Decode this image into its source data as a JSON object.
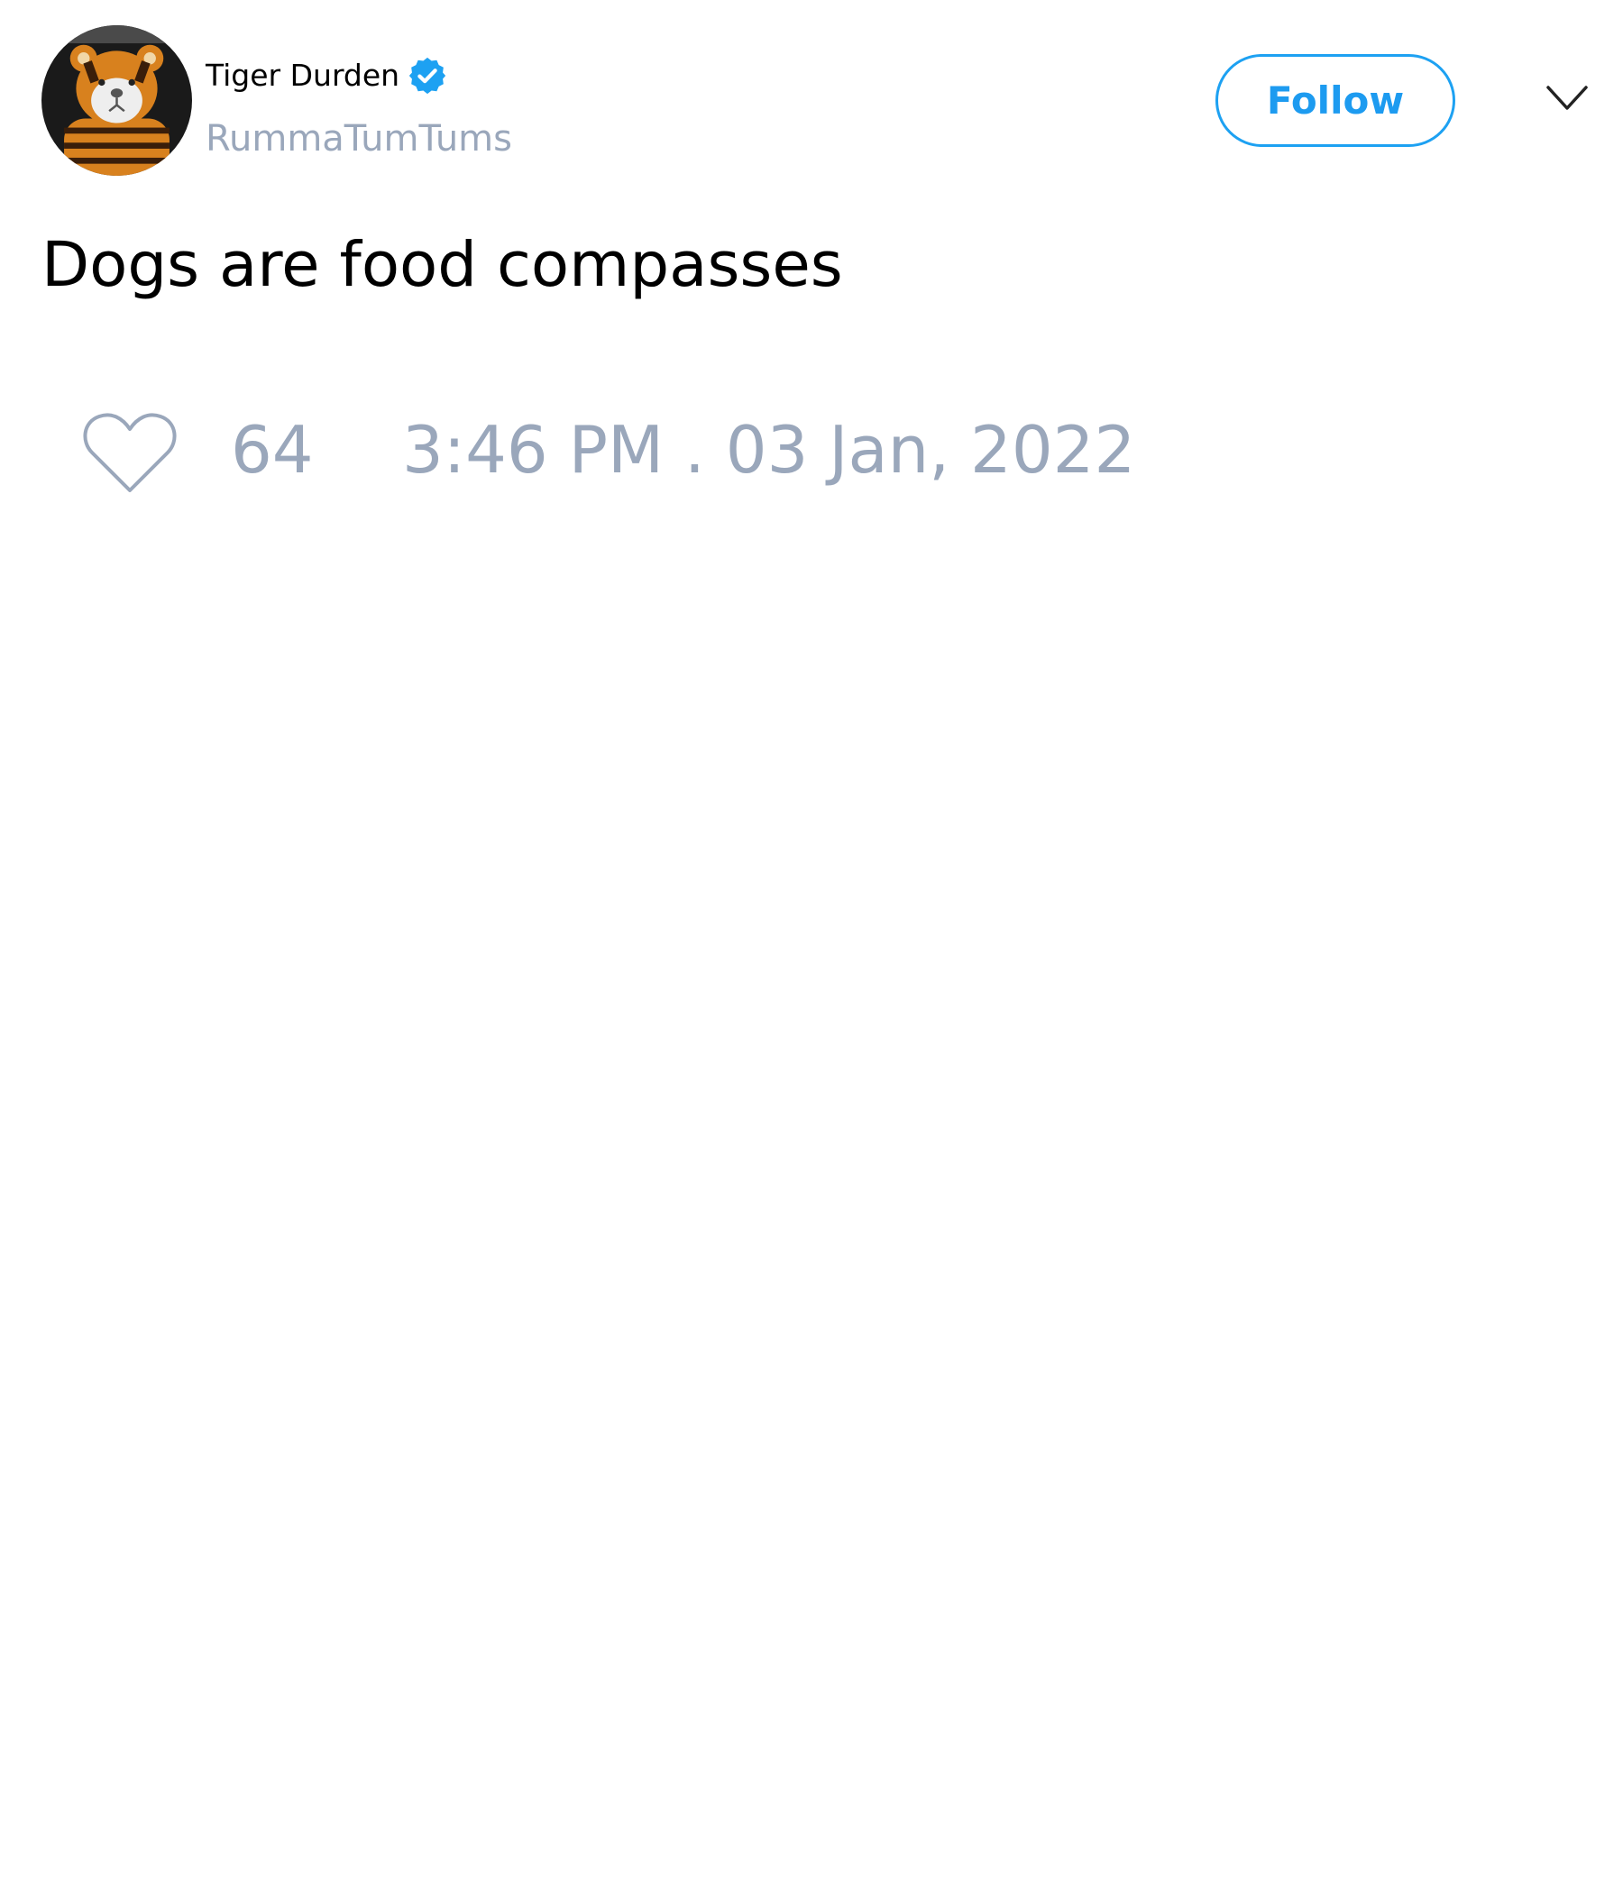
{
  "author": {
    "display_name": "Tiger Durden",
    "handle": "RummaTumTums",
    "verified": true,
    "avatar_icon": "tiger-plush-avatar"
  },
  "actions": {
    "follow_label": "Follow",
    "more_icon": "chevron-down-icon"
  },
  "tweet": {
    "text": "Dogs are food compasses"
  },
  "footer": {
    "like_icon": "heart-outline-icon",
    "like_count": "64",
    "timestamp": "3:46 PM . 03 Jan, 2022"
  },
  "colors": {
    "accent": "#1da1f2",
    "muted_text": "#9aa7bb",
    "text": "#000000",
    "background": "#ffffff"
  }
}
